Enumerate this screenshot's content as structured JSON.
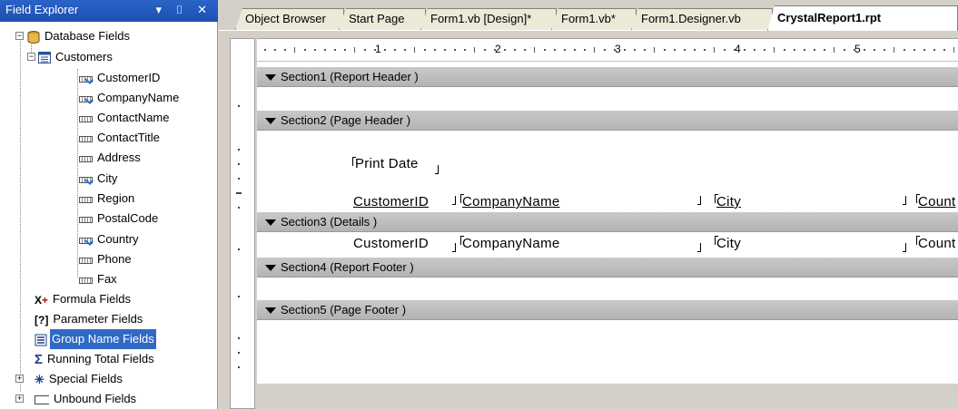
{
  "explorer": {
    "title": "Field Explorer",
    "title_buttons": "▾ ⌷ ✕",
    "items": [
      {
        "label": "Database Fields",
        "icon": "database-icon"
      },
      {
        "label": "Customers",
        "icon": "table-icon"
      },
      {
        "label": "CustomerID",
        "icon": "field-used-icon"
      },
      {
        "label": "CompanyName",
        "icon": "field-used-icon"
      },
      {
        "label": "ContactName",
        "icon": "field-icon"
      },
      {
        "label": "ContactTitle",
        "icon": "field-icon"
      },
      {
        "label": "Address",
        "icon": "field-icon"
      },
      {
        "label": "City",
        "icon": "field-used-icon"
      },
      {
        "label": "Region",
        "icon": "field-icon"
      },
      {
        "label": "PostalCode",
        "icon": "field-icon"
      },
      {
        "label": "Country",
        "icon": "field-used-icon"
      },
      {
        "label": "Phone",
        "icon": "field-icon"
      },
      {
        "label": "Fax",
        "icon": "field-icon"
      },
      {
        "label": "Formula Fields",
        "icon": "formula-icon"
      },
      {
        "label": "Parameter Fields",
        "icon": "parameter-icon"
      },
      {
        "label": "Group Name Fields",
        "icon": "group-name-icon"
      },
      {
        "label": "Running Total Fields",
        "icon": "sigma-icon"
      },
      {
        "label": "Special Fields",
        "icon": "special-icon"
      },
      {
        "label": "Unbound Fields",
        "icon": "unbound-icon"
      }
    ],
    "selected_item": "Group Name Fields"
  },
  "tabs": [
    {
      "label": "Object Browser"
    },
    {
      "label": "Start Page"
    },
    {
      "label": "Form1.vb [Design]*"
    },
    {
      "label": "Form1.vb*"
    },
    {
      "label": "Form1.Designer.vb"
    },
    {
      "label": "CrystalReport1.rpt"
    }
  ],
  "active_tab": "CrystalReport1.rpt",
  "ruler": {
    "numbers": [
      "1",
      "2",
      "3",
      "4",
      "5"
    ]
  },
  "sections": [
    {
      "label": "Section1 (Report Header )"
    },
    {
      "label": "Section2 (Page Header )"
    },
    {
      "label": "Section3 (Details )"
    },
    {
      "label": "Section4 (Report Footer )"
    },
    {
      "label": "Section5 (Page Footer )"
    }
  ],
  "page_header": {
    "print_date": "Print Date",
    "headings": [
      "CustomerID",
      "CompanyName",
      "City",
      "Count"
    ]
  },
  "details": {
    "fields": [
      "CustomerID",
      "CompanyName",
      "City",
      "Count"
    ]
  },
  "colors": {
    "titlebar": "#2a63c8",
    "selection": "#316ac5",
    "section_bar": "#c0c0c0"
  }
}
